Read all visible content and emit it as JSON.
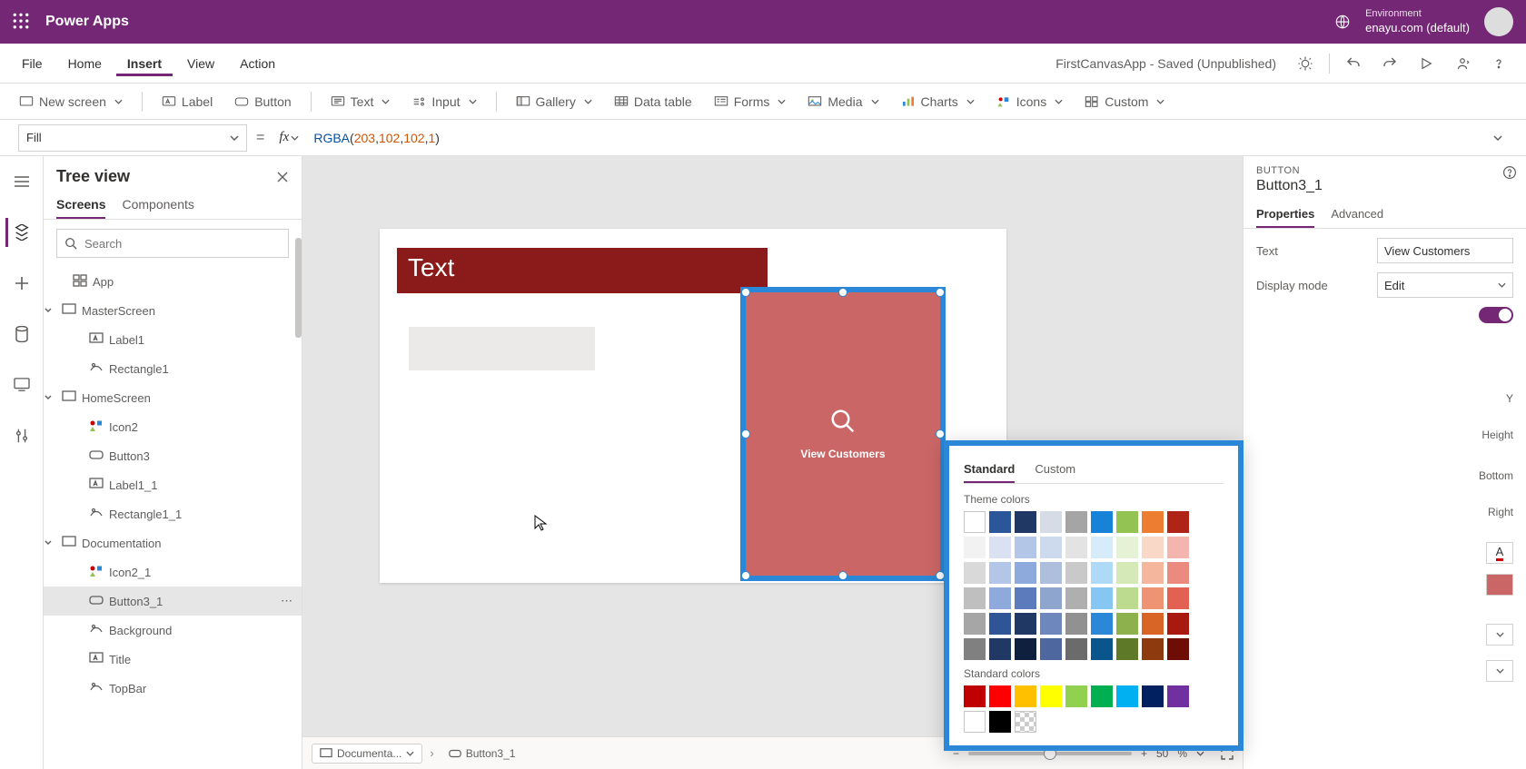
{
  "titlebar": {
    "brand": "Power Apps",
    "env_label": "Environment",
    "env_value": "enayu.com (default)"
  },
  "menu": {
    "items": [
      "File",
      "Home",
      "Insert",
      "View",
      "Action"
    ],
    "active": "Insert",
    "status": "FirstCanvasApp - Saved (Unpublished)"
  },
  "ribbon": {
    "newScreen": "New screen",
    "label": "Label",
    "button": "Button",
    "text": "Text",
    "input": "Input",
    "gallery": "Gallery",
    "dataTable": "Data table",
    "forms": "Forms",
    "media": "Media",
    "charts": "Charts",
    "icons": "Icons",
    "custom": "Custom"
  },
  "formula": {
    "property": "Fill",
    "fn": "RGBA",
    "args": [
      "203",
      "102",
      "102",
      "1"
    ]
  },
  "tree": {
    "title": "Tree view",
    "tabs": [
      "Screens",
      "Components"
    ],
    "activeTab": "Screens",
    "searchPlaceholder": "Search",
    "items": [
      {
        "indent": 0,
        "name": "App",
        "icon": "app",
        "chev": false
      },
      {
        "indent": 0,
        "name": "MasterScreen",
        "icon": "screen",
        "chev": true
      },
      {
        "indent": 1,
        "name": "Label1",
        "icon": "label"
      },
      {
        "indent": 1,
        "name": "Rectangle1",
        "icon": "rect"
      },
      {
        "indent": 0,
        "name": "HomeScreen",
        "icon": "screen",
        "chev": true
      },
      {
        "indent": 1,
        "name": "Icon2",
        "icon": "icon"
      },
      {
        "indent": 1,
        "name": "Button3",
        "icon": "button"
      },
      {
        "indent": 1,
        "name": "Label1_1",
        "icon": "label"
      },
      {
        "indent": 1,
        "name": "Rectangle1_1",
        "icon": "rect"
      },
      {
        "indent": 0,
        "name": "Documentation",
        "icon": "screen",
        "chev": true
      },
      {
        "indent": 1,
        "name": "Icon2_1",
        "icon": "icon"
      },
      {
        "indent": 1,
        "name": "Button3_1",
        "icon": "button",
        "selected": true,
        "more": true
      },
      {
        "indent": 1,
        "name": "Background",
        "icon": "rect"
      },
      {
        "indent": 1,
        "name": "Title",
        "icon": "label"
      },
      {
        "indent": 1,
        "name": "TopBar",
        "icon": "rect"
      }
    ]
  },
  "canvas": {
    "label_text": "Text",
    "button_text": "View Customers",
    "breadcrumb": [
      {
        "label": "Documenta...",
        "drop": true
      },
      {
        "label": "Button3_1"
      }
    ],
    "zoom": {
      "value": "50",
      "unit": "%"
    }
  },
  "props": {
    "type": "BUTTON",
    "name": "Button3_1",
    "tabs": [
      "Properties",
      "Advanced"
    ],
    "activeTab": "Properties",
    "rows": {
      "Text": "View Customers",
      "DisplayMode": "Edit"
    },
    "peeks": [
      "Y",
      "Height",
      "Bottom",
      "Right"
    ]
  },
  "picker": {
    "tabs": [
      "Standard",
      "Custom"
    ],
    "activeTab": "Standard",
    "themeLabel": "Theme colors",
    "stdLabel": "Standard colors",
    "theme": [
      [
        "#ffffff",
        "#2b579a",
        "#1f3864",
        "#d6dce5",
        "#a5a5a5",
        "#1683d8",
        "#92c353",
        "#ed7d31",
        "#b02418"
      ],
      [
        "#f2f2f2",
        "#d9e1f2",
        "#b4c6e7",
        "#cdd9ed",
        "#e3e3e3",
        "#d6ecfb",
        "#e6f2d6",
        "#f9d8c8",
        "#f4b5ae"
      ],
      [
        "#d9d9d9",
        "#b4c6e7",
        "#8ea9db",
        "#aebfde",
        "#c9c9c9",
        "#aed9f7",
        "#d4e8b8",
        "#f4b69d",
        "#eb8b80"
      ],
      [
        "#bfbfbf",
        "#8ea9db",
        "#5b7bbd",
        "#8ea5ce",
        "#afafaf",
        "#85c6f2",
        "#bcdb8f",
        "#ef9472",
        "#e36152"
      ],
      [
        "#a6a6a6",
        "#2f5597",
        "#203864",
        "#6e88be",
        "#919191",
        "#2b88d8",
        "#8db14c",
        "#d86525",
        "#a8190f"
      ],
      [
        "#808080",
        "#1f3864",
        "#0f1f3e",
        "#4e679e",
        "#6b6b6b",
        "#0a558c",
        "#5e7a28",
        "#8e3a0f",
        "#6e0d06"
      ]
    ],
    "standard": [
      [
        "#c00000",
        "#ff0000",
        "#ffc000",
        "#ffff00",
        "#92d050",
        "#00b050",
        "#00b0f0",
        "#002060",
        "#7030a0"
      ],
      [
        "#ffffff",
        "#000000",
        "transparent"
      ]
    ]
  }
}
